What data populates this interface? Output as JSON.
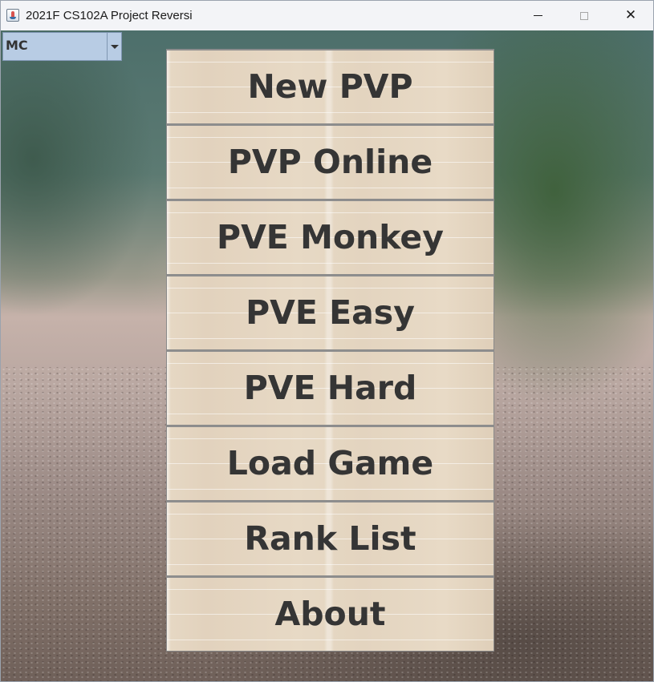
{
  "window": {
    "title": "2021F CS102A Project Reversi",
    "controls": {
      "minimize_icon": "minimize-icon",
      "maximize_icon": "maximize-icon",
      "close_icon": "close-icon",
      "close_glyph": "✕"
    }
  },
  "selector": {
    "value": "MC",
    "arrow_icon": "chevron-down-icon"
  },
  "menu": {
    "items": [
      {
        "label": "New PVP"
      },
      {
        "label": "PVP Online"
      },
      {
        "label": "PVE Monkey"
      },
      {
        "label": "PVE Easy"
      },
      {
        "label": "PVE Hard"
      },
      {
        "label": "Load Game"
      },
      {
        "label": "Rank List"
      },
      {
        "label": "About"
      }
    ]
  },
  "colors": {
    "button_face": "#e6d8c4",
    "button_text": "#353535",
    "selector_bg": "#b8cce4"
  }
}
